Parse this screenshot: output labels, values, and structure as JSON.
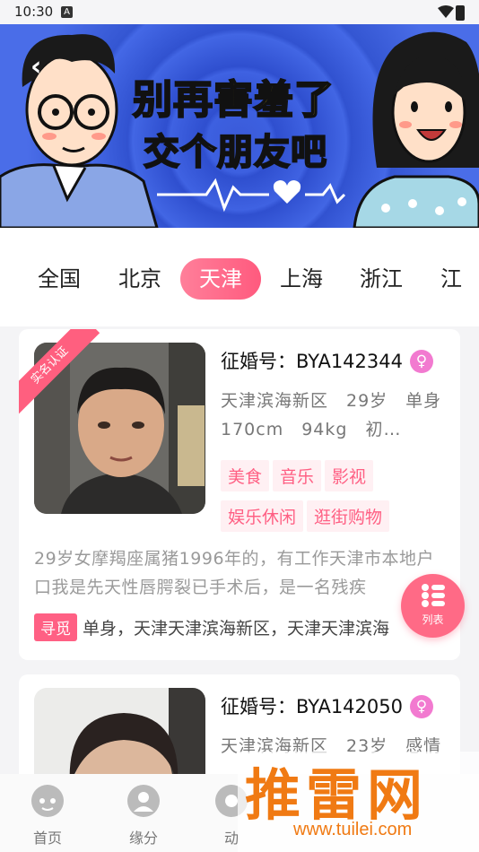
{
  "status_bar": {
    "time": "10:30",
    "notif_letter": "A"
  },
  "banner": {
    "line1": "别再害羞了",
    "line2": "交个朋友吧"
  },
  "city_tabs": [
    {
      "label": "全国",
      "active": false
    },
    {
      "label": "北京",
      "active": false
    },
    {
      "label": "天津",
      "active": true
    },
    {
      "label": "上海",
      "active": false
    },
    {
      "label": "浙江",
      "active": false
    },
    {
      "label": "江",
      "active": false
    }
  ],
  "cards": [
    {
      "badge": "实名认证",
      "id_label": "征婚号：",
      "id": "BYA142344",
      "gender_symbol": "♀",
      "info": "天津滨海新区　29岁　单身　170cm　94kg　初…",
      "tags": [
        "美食",
        "音乐",
        "影视",
        "娱乐休闲",
        "逛街购物"
      ],
      "description": "29岁女摩羯座属猪1996年的，有工作天津市本地户口我是先天性唇腭裂已手术后，是一名残疾",
      "seek_label": "寻觅",
      "seek_text": "单身，天津天津滨海新区，天津天津滨海"
    },
    {
      "id_label": "征婚号：",
      "id": "BYA142050",
      "gender_symbol": "♀",
      "info": "天津滨海新区　23岁　感情"
    }
  ],
  "fab": {
    "label": "列表"
  },
  "bottom_nav": [
    {
      "label": "首页",
      "icon": "home-icon"
    },
    {
      "label": "缘分",
      "icon": "match-icon"
    },
    {
      "label": "动",
      "icon": "moments-icon"
    }
  ],
  "watermark": {
    "text": "推雷网",
    "url": "www.tuilei.com"
  },
  "colors": {
    "accent": "#ff5f83",
    "banner_blue": "#3f62e2",
    "title_yellow": "#ffe21a"
  }
}
